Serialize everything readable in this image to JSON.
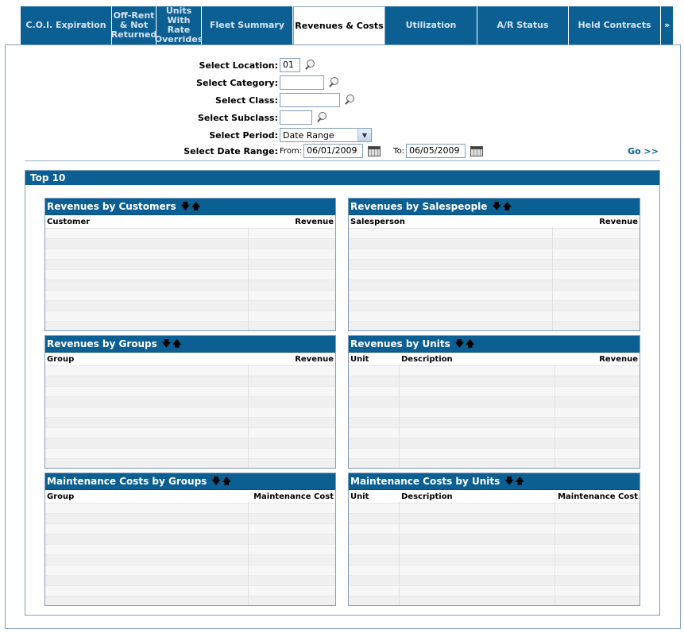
{
  "tabs": [
    {
      "label": "C.O.I. Expiration",
      "active": false
    },
    {
      "label": "Off-Rent & Not Returned",
      "active": false
    },
    {
      "label": "Units With Rate Overrides",
      "active": false
    },
    {
      "label": "Fleet Summary",
      "active": false
    },
    {
      "label": "Revenues & Costs",
      "active": true
    },
    {
      "label": "Utilization",
      "active": false
    },
    {
      "label": "A/R Status",
      "active": false
    },
    {
      "label": "Held Contracts",
      "active": false
    },
    {
      "label": "»",
      "active": false
    }
  ],
  "form": {
    "location_label": "Select Location:",
    "location_value": "01",
    "category_label": "Select Category:",
    "category_value": "",
    "class_label": "Select Class:",
    "class_value": "",
    "subclass_label": "Select Subclass:",
    "subclass_value": "",
    "period_label": "Select Period:",
    "period_value": "Date Range",
    "daterange_label": "Select Date Range:",
    "from_label": "From:",
    "from_value": "06/01/2009",
    "to_label": "To:",
    "to_value": "06/05/2009",
    "go_label": "Go >>"
  },
  "top10": {
    "title": "Top 10",
    "panels": {
      "rev_customers": {
        "title": "Revenues by Customers",
        "columns": [
          "Customer",
          "Revenue"
        ]
      },
      "rev_salespeople": {
        "title": "Revenues by Salespeople",
        "columns": [
          "Salesperson",
          "Revenue"
        ]
      },
      "rev_groups": {
        "title": "Revenues by Groups",
        "columns": [
          "Group",
          "Revenue"
        ]
      },
      "rev_units": {
        "title": "Revenues by Units",
        "columns": [
          "Unit",
          "Description",
          "Revenue"
        ]
      },
      "maint_groups": {
        "title": "Maintenance Costs by Groups",
        "columns": [
          "Group",
          "Maintenance Cost"
        ]
      },
      "maint_units": {
        "title": "Maintenance Costs by Units",
        "columns": [
          "Unit",
          "Description",
          "Maintenance Cost"
        ]
      }
    }
  },
  "icons": {
    "lookup": "magnifier-icon",
    "calendar": "calendar-icon",
    "sort_desc": "arrow-down-icon",
    "sort_asc": "arrow-up-icon",
    "dropdown": "chevron-down-icon"
  },
  "colors": {
    "accent": "#0b5f93",
    "border": "#7f9db9"
  }
}
